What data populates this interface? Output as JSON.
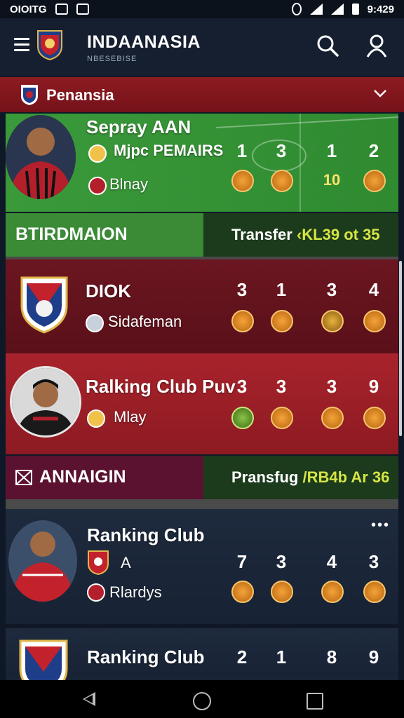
{
  "status_bar": {
    "time_left": "OIOITG",
    "time_right": "9:429"
  },
  "app": {
    "title": "INDAANASIA",
    "subtitle": "NBESEBISE"
  },
  "league": {
    "name": "Penansia"
  },
  "cards": [
    {
      "title": "Sepray AAN",
      "line1": "Mjpc PEMAIRS",
      "line2": "Blnay",
      "values": [
        "1",
        "3",
        "1",
        "2"
      ],
      "badge_values": [
        "",
        "",
        "10",
        ""
      ]
    },
    {
      "title": "DIOK",
      "line1": "Sidafeman",
      "values": [
        "3",
        "1",
        "3",
        "4"
      ]
    },
    {
      "title": "Ralking Club Puv",
      "line1": "Mlay",
      "values": [
        "3",
        "3",
        "3",
        "9"
      ]
    },
    {
      "title": "Ranking Club",
      "line1": "A",
      "line2": "Rlardys",
      "values": [
        "7",
        "3",
        "4",
        "3"
      ]
    },
    {
      "title": "Ranking Club",
      "values": [
        "2",
        "1",
        "8",
        "9"
      ]
    }
  ],
  "strips": [
    {
      "label": "BTIRDMAION",
      "transfer_text": "Transfer",
      "transfer_value": "‹KL39 ot 35"
    },
    {
      "label": "ANNAIGIN",
      "transfer_text": "Pransfug",
      "transfer_value": "/RB4b Ar 36"
    }
  ],
  "more_label": "•••",
  "colors": {
    "accent": "#3aa7e6",
    "league_bar": "#8e1b22",
    "pitch": "#3a9a3a",
    "maroon": "#6b1620",
    "red": "#a8232c",
    "navy": "#1e2a3d"
  }
}
